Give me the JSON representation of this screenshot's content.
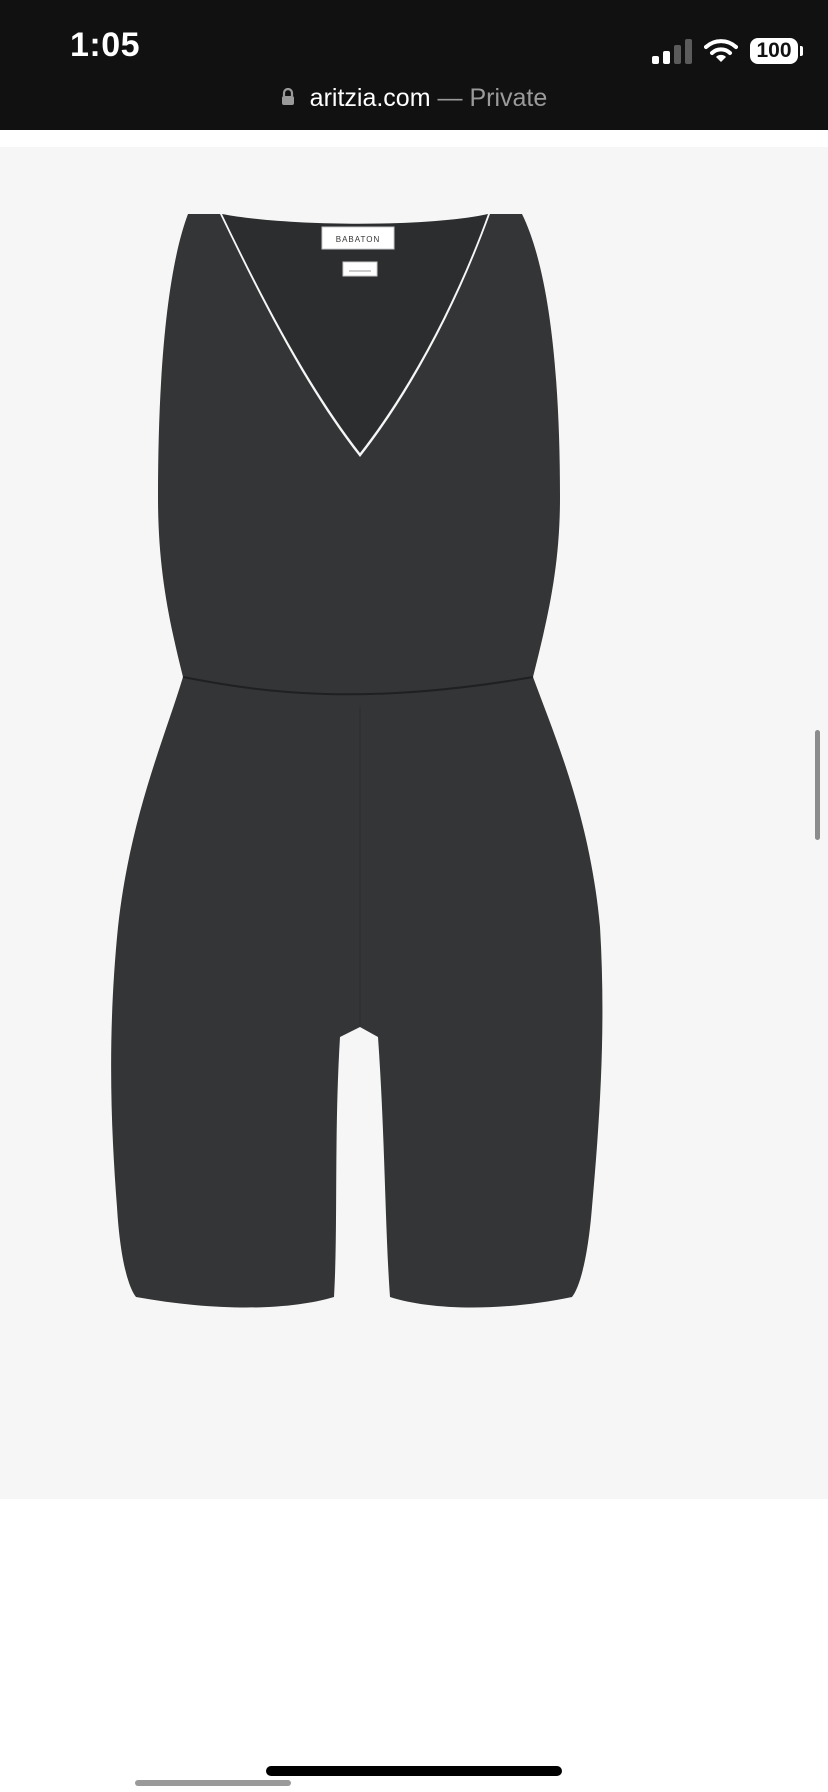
{
  "status_bar": {
    "time": "1:05",
    "battery": "100",
    "icons": [
      "signal-icon",
      "wifi-icon",
      "battery-icon"
    ]
  },
  "browser": {
    "domain": "aritzia.com",
    "separator_private": "— Private",
    "icons": [
      "lock-icon"
    ]
  },
  "product": {
    "image_label": "BABATON",
    "garment_color": "#333536",
    "background": "#f6f6f6"
  }
}
